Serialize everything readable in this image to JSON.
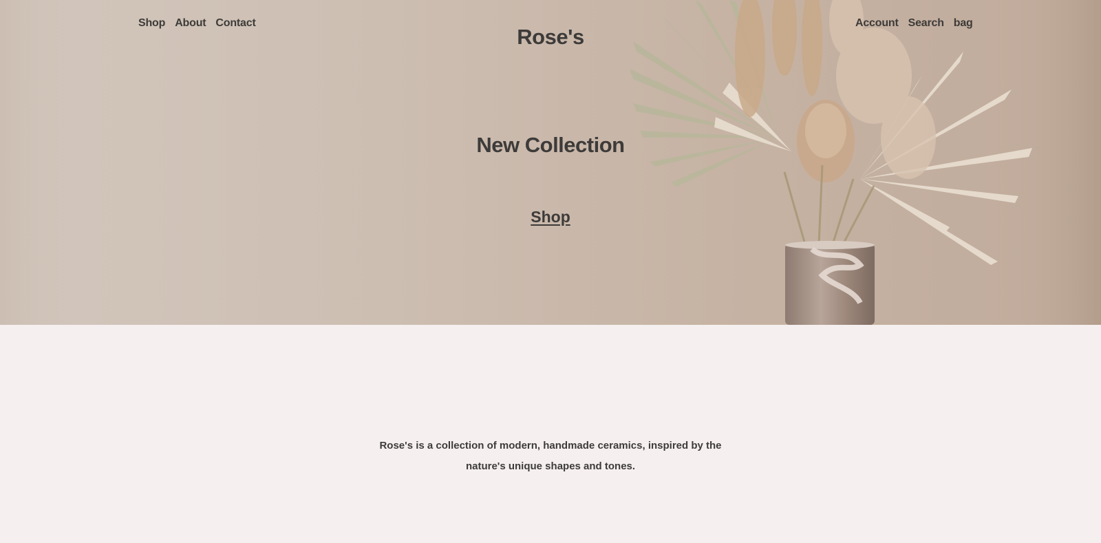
{
  "header": {
    "nav_left": [
      "Shop",
      "About",
      "Contact"
    ],
    "brand": "Rose's",
    "nav_right": [
      "Account",
      "Search",
      "bag"
    ]
  },
  "hero": {
    "title": "New Collection",
    "cta_label": "Shop",
    "image": "dried-flower-bouquet-in-marble-vase"
  },
  "intro": {
    "text": "Rose's is a collection of modern, handmade ceramics, inspired by the nature's unique shapes and tones."
  },
  "colors": {
    "page_background": "#f5f0ef",
    "hero_background": "#cdbeb2",
    "text": "#3d3b39"
  }
}
